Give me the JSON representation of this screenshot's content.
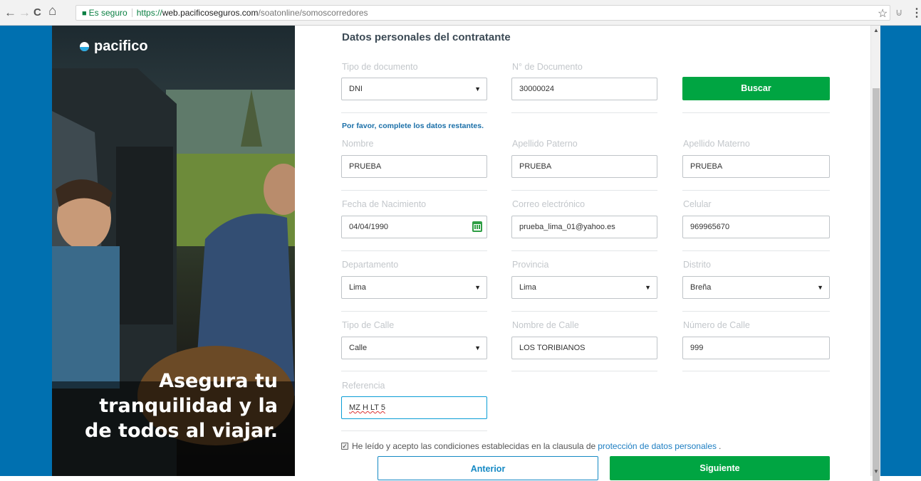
{
  "browser": {
    "back_glyph": "←",
    "forward_glyph": "→",
    "reload_glyph": "C",
    "home_glyph": "⌂",
    "lock_glyph": "🔒",
    "secure_label": "Es seguro",
    "url_protocol": "https://",
    "url_host": "web.pacificoseguros.com",
    "url_path": "/soatonline/somoscorredores",
    "star_glyph": "☆",
    "ext_glyph": "⊍",
    "menu_glyph": "⋮"
  },
  "brand": {
    "logo_text": "pacifico",
    "tagline_line1": "Asegura tu",
    "tagline_line2": "tranquilidad y la",
    "tagline_line3": "de todos al viajar.",
    "primary_color": "#00a542",
    "blue_color": "#0070b0"
  },
  "form": {
    "section_title": "Datos personales del contratante",
    "doc_type": {
      "label": "Tipo de documento",
      "value": "DNI"
    },
    "doc_number": {
      "label": "N° de Documento",
      "value": "30000024"
    },
    "search_button": "Buscar",
    "notice": "Por favor, complete los datos restantes.",
    "first_name": {
      "label": "Nombre",
      "value": "PRUEBA"
    },
    "last_name_paternal": {
      "label": "Apellido Paterno",
      "value": "PRUEBA"
    },
    "last_name_maternal": {
      "label": "Apellido Materno",
      "value": "PRUEBA"
    },
    "birth_date": {
      "label": "Fecha de Nacimiento",
      "value": "04/04/1990"
    },
    "email": {
      "label": "Correo electrónico",
      "value": "prueba_lima_01@yahoo.es"
    },
    "phone": {
      "label": "Celular",
      "value": "969965670"
    },
    "department": {
      "label": "Departamento",
      "value": "Lima"
    },
    "province": {
      "label": "Provincia",
      "value": "Lima"
    },
    "district": {
      "label": "Distrito",
      "value": "Breña"
    },
    "street_type": {
      "label": "Tipo de Calle",
      "value": "Calle"
    },
    "street_name": {
      "label": "Nombre de Calle",
      "value": "LOS TORIBIANOS"
    },
    "street_number": {
      "label": "Número de Calle",
      "value": "999"
    },
    "reference": {
      "label": "Referencia",
      "value": "MZ H LT 5"
    },
    "terms_text": "He leído y acepto las condiciones establecidas en la clausula de",
    "terms_link": "protección de datos personales",
    "terms_suffix": ".",
    "terms_checked": true,
    "back_button": "Anterior",
    "next_button": "Siguiente"
  }
}
